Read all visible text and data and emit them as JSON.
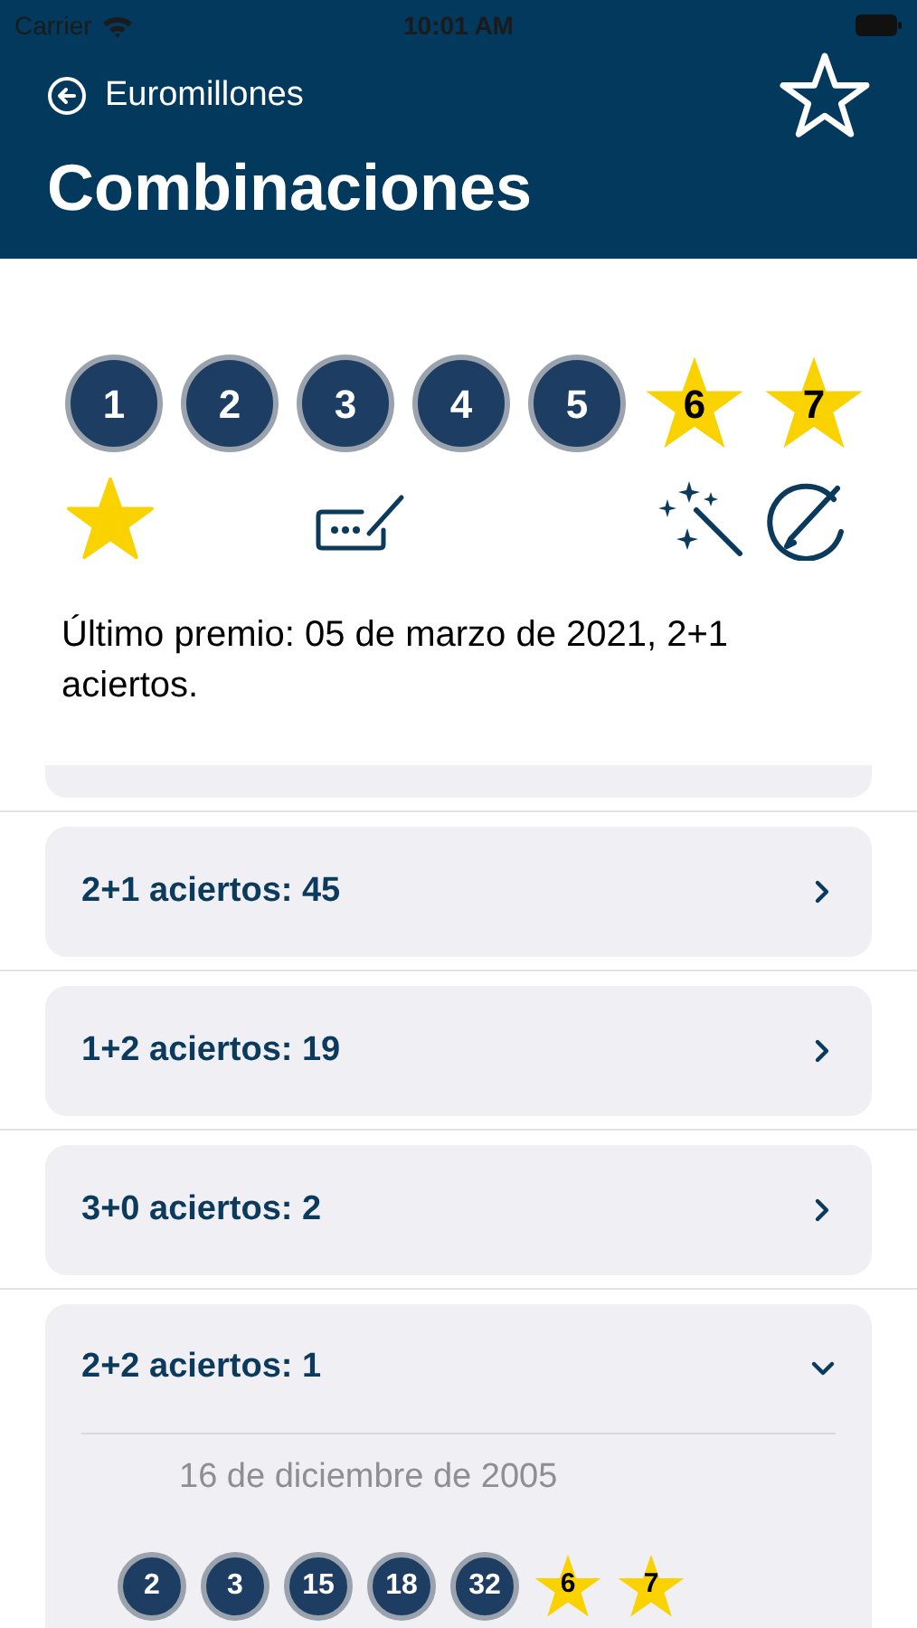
{
  "status_bar": {
    "carrier": "Carrier",
    "time": "10:01 AM"
  },
  "nav": {
    "back_label": "Euromillones",
    "favorite": false,
    "title": "Combinaciones"
  },
  "combination": {
    "balls": [
      {
        "kind": "number",
        "label": "1"
      },
      {
        "kind": "number",
        "label": "2"
      },
      {
        "kind": "number",
        "label": "3"
      },
      {
        "kind": "number",
        "label": "4"
      },
      {
        "kind": "number",
        "label": "5"
      },
      {
        "kind": "star",
        "label": "6"
      },
      {
        "kind": "star",
        "label": "7"
      }
    ],
    "favorite": true
  },
  "last_prize": "Último premio: 05 de marzo de 2021, 2+1 aciertos.",
  "results": [
    {
      "label": "2+1 aciertos: 45",
      "expanded": false
    },
    {
      "label": "1+2 aciertos: 19",
      "expanded": false
    },
    {
      "label": "3+0 aciertos: 2",
      "expanded": false
    },
    {
      "label": "2+2 aciertos: 1",
      "expanded": true,
      "draws": [
        {
          "date": "16 de diciembre de 2005",
          "balls": [
            {
              "kind": "number",
              "label": "2"
            },
            {
              "kind": "number",
              "label": "3"
            },
            {
              "kind": "number",
              "label": "15"
            },
            {
              "kind": "number",
              "label": "18"
            },
            {
              "kind": "number",
              "label": "32"
            },
            {
              "kind": "star",
              "label": "6"
            },
            {
              "kind": "star",
              "label": "7"
            }
          ]
        }
      ]
    }
  ]
}
